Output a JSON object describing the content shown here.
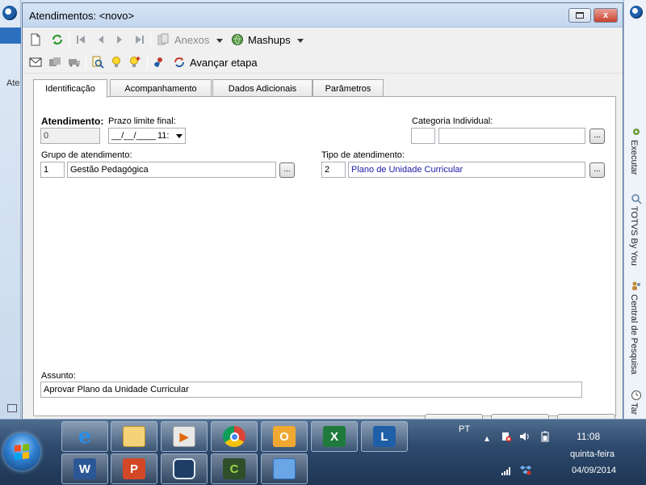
{
  "background": {
    "left_label": "Ate",
    "right_tabs": [
      "Executar",
      "TOTVS By You",
      "Central de Pesquisa",
      "Tar"
    ]
  },
  "window": {
    "title": "Atendimentos: <novo>",
    "close_glyph": "x"
  },
  "toolbar": {
    "anexos_label": "Anexos",
    "mashups_label": "Mashups",
    "avancar_label": "Avançar etapa"
  },
  "tabs": [
    {
      "label": "Identificação",
      "active": true
    },
    {
      "label": "Acompanhamento",
      "active": false
    },
    {
      "label": "Dados Adicionais",
      "active": false
    },
    {
      "label": "Parâmetros",
      "active": false
    }
  ],
  "form": {
    "atendimento_label": "Atendimento:",
    "atendimento_value": "0",
    "prazo_label": "Prazo limite final:",
    "prazo_date": "__/__/____",
    "prazo_time": "11:",
    "categoria_label": "Categoria Individual:",
    "categoria_code": "",
    "categoria_name": "",
    "grupo_label": "Grupo de atendimento:",
    "grupo_code": "1",
    "grupo_name": "Gestão Pedagógica",
    "tipo_label": "Tipo de atendimento:",
    "tipo_code": "2",
    "tipo_name": "Plano de Unidade Curricular",
    "assunto_label": "Assunto:",
    "assunto_value": "Aprovar Plano da Unidade Curricular",
    "ellipsis": "..."
  },
  "taskbar": {
    "language": "PT",
    "time": "11:08",
    "weekday": "quinta-feira",
    "date": "04/09/2014",
    "apps_row1": [
      "internet-explorer",
      "file-explorer",
      "media-player",
      "chrome",
      "outlook",
      "excel",
      "lync"
    ],
    "apps_row2": [
      "word",
      "powerpoint",
      "virtualbox",
      "camtasia",
      "control-panel"
    ]
  },
  "colors": {
    "link_blue": "#1a1aa6",
    "title_bar": "#c3d6ee",
    "close_red": "#c9412e",
    "taskbar": "#2e4a6d"
  }
}
